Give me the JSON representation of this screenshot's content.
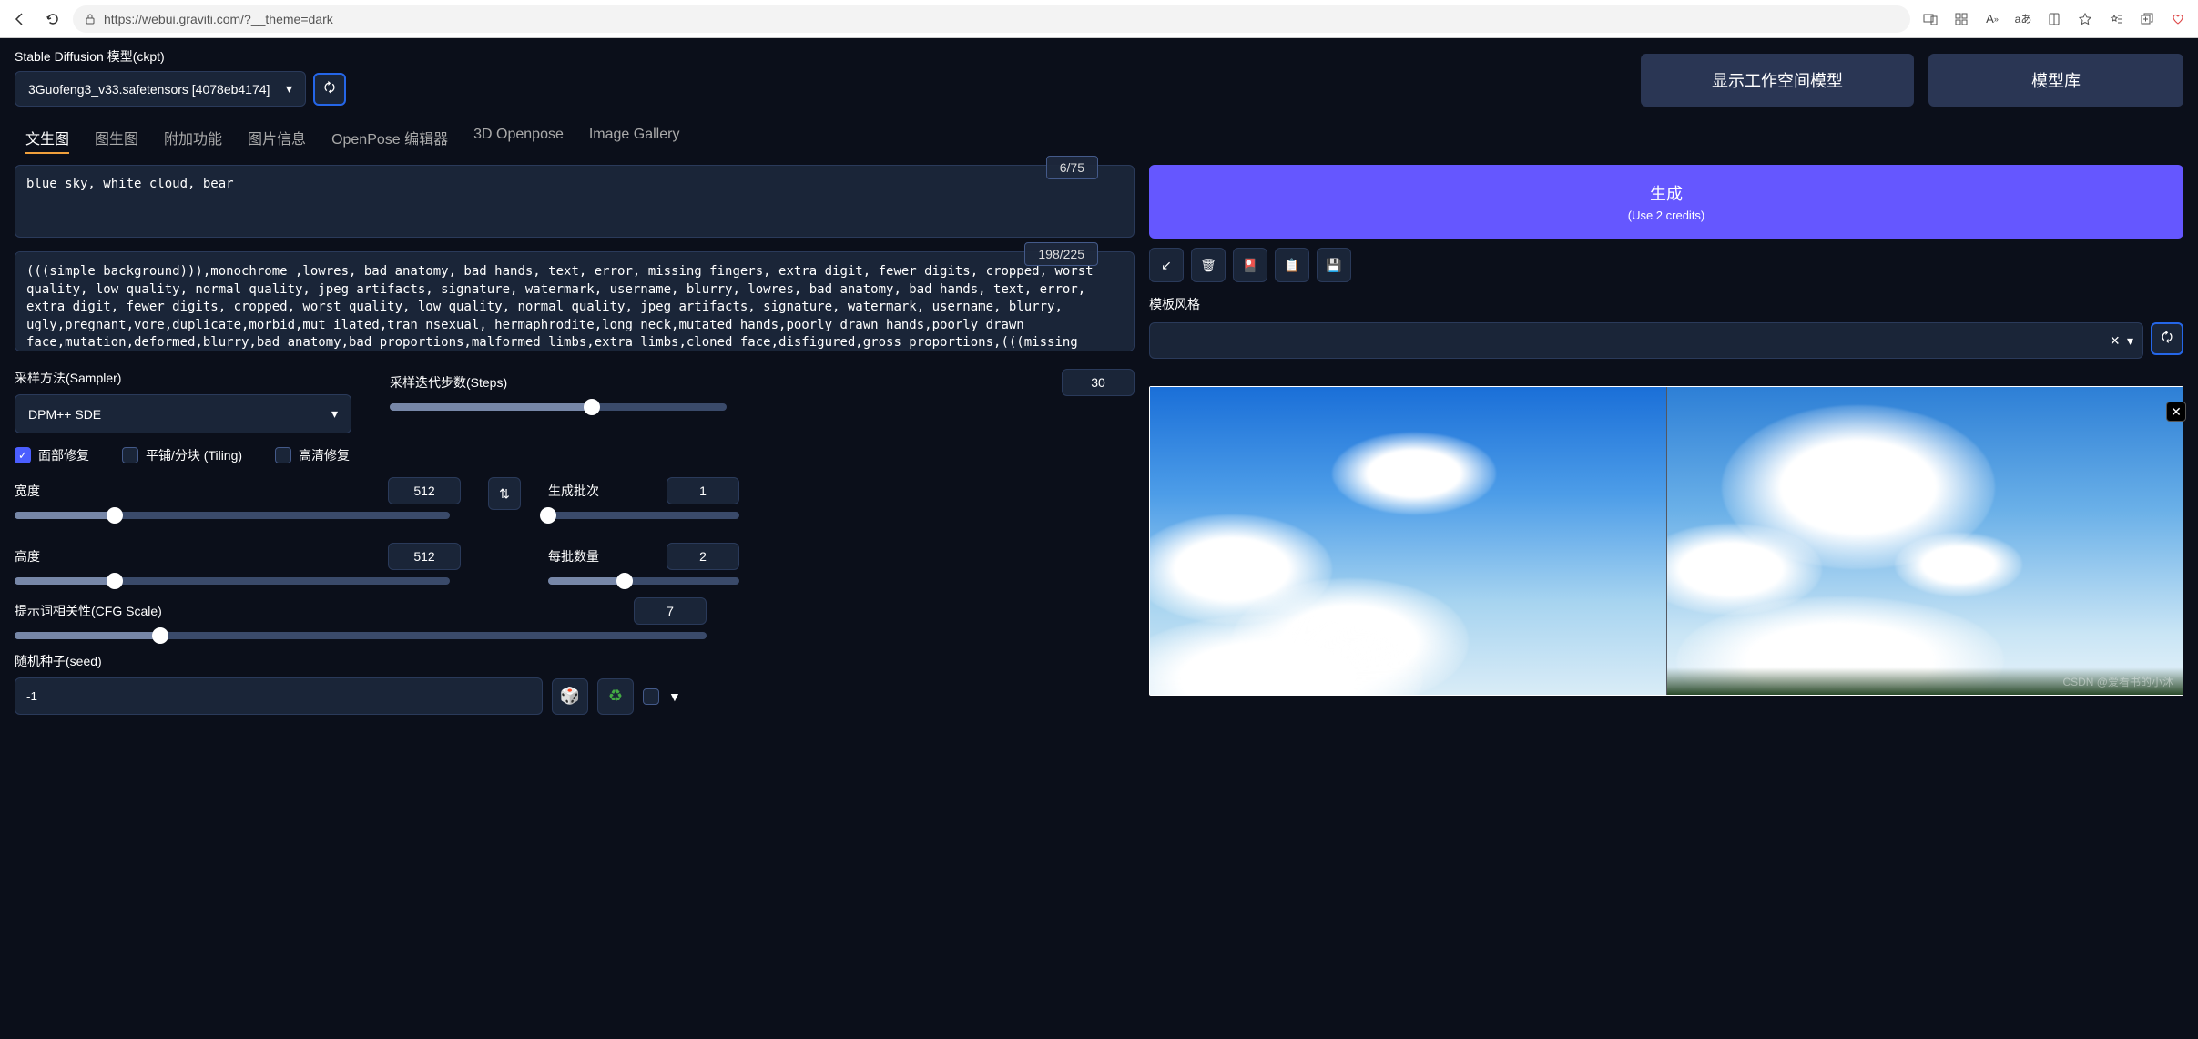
{
  "browser": {
    "url": "https://webui.graviti.com/?__theme=dark"
  },
  "header": {
    "model_label": "Stable Diffusion 模型(ckpt)",
    "model_value": "3Guofeng3_v33.safetensors [4078eb4174]",
    "workspace_btn": "显示工作空间模型",
    "library_btn": "模型库"
  },
  "tabs": [
    {
      "label": "文生图",
      "active": true
    },
    {
      "label": "图生图",
      "active": false
    },
    {
      "label": "附加功能",
      "active": false
    },
    {
      "label": "图片信息",
      "active": false
    },
    {
      "label": "OpenPose 编辑器",
      "active": false
    },
    {
      "label": "3D Openpose",
      "active": false
    },
    {
      "label": "Image Gallery",
      "active": false
    }
  ],
  "prompt": {
    "positive": "blue sky, white cloud, bear",
    "positive_counter": "6/75",
    "negative": "(((simple background))),monochrome ,lowres, bad anatomy, bad hands, text, error, missing fingers, extra digit, fewer digits, cropped, worst quality, low quality, normal quality, jpeg artifacts, signature, watermark, username, blurry, lowres, bad anatomy, bad hands, text, error, extra digit, fewer digits, cropped, worst quality, low quality, normal quality, jpeg artifacts, signature, watermark, username, blurry, ugly,pregnant,vore,duplicate,morbid,mut ilated,tran nsexual, hermaphrodite,long neck,mutated hands,poorly drawn hands,poorly drawn face,mutation,deformed,blurry,bad anatomy,bad proportions,malformed limbs,extra limbs,cloned face,disfigured,gross proportions,(((missing arms))),(((missing legs))), (((extra arms))),(((extra legs))),pubic hair, plump,bad legs,error legs,username,blurry,bad feet",
    "negative_counter": "198/225"
  },
  "sampler": {
    "label": "采样方法(Sampler)",
    "value": "DPM++ SDE"
  },
  "steps": {
    "label": "采样迭代步数(Steps)",
    "value": "30",
    "pct": 60
  },
  "checks": {
    "face": {
      "label": "面部修复",
      "checked": true
    },
    "tiling": {
      "label": "平铺/分块 (Tiling)",
      "checked": false
    },
    "hires": {
      "label": "高清修复",
      "checked": false
    }
  },
  "width": {
    "label": "宽度",
    "value": "512",
    "pct": 23
  },
  "height": {
    "label": "高度",
    "value": "512",
    "pct": 23
  },
  "batch_count": {
    "label": "生成批次",
    "value": "1",
    "pct": 0
  },
  "batch_size": {
    "label": "每批数量",
    "value": "2",
    "pct": 40
  },
  "cfg": {
    "label": "提示词相关性(CFG Scale)",
    "value": "7",
    "pct": 21
  },
  "seed": {
    "label": "随机种子(seed)",
    "value": "-1"
  },
  "generate": {
    "label": "生成",
    "sub": "(Use 2 credits)"
  },
  "style": {
    "label": "模板风格",
    "clear": "×"
  },
  "watermark": "CSDN @爱看书的小沐",
  "icons": {
    "arrow": "↙",
    "trash": "🗑",
    "card": "🎴",
    "clipboard": "📋",
    "save": "💾",
    "dice": "🎲",
    "recycle": "♻",
    "dropdown": "▼",
    "swap": "⇅",
    "close_x": "✕",
    "refresh": "🗘"
  }
}
